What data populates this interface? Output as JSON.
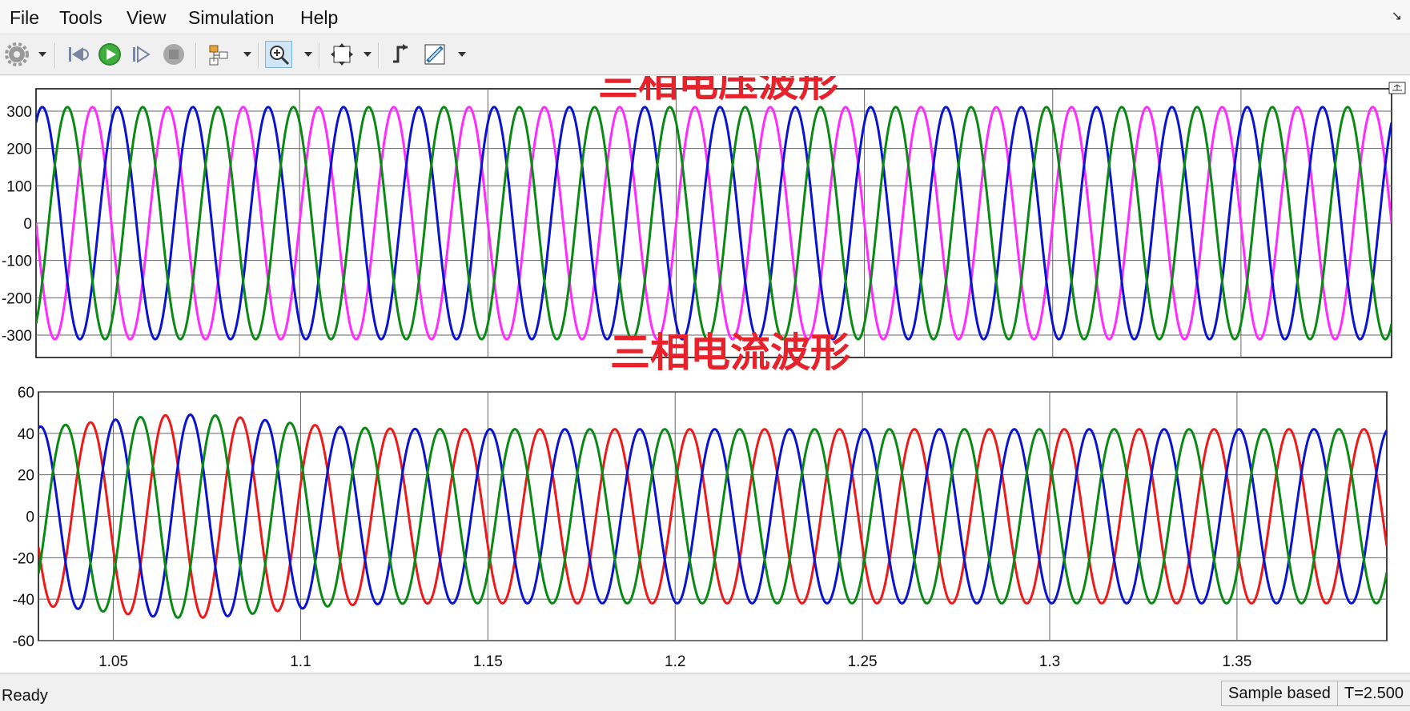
{
  "menu": [
    "File",
    "Tools",
    "View",
    "Simulation",
    "Help"
  ],
  "toolbar": {
    "icons": [
      "gear-icon",
      "step-back-icon",
      "run-icon",
      "step-forward-icon",
      "stop-icon",
      "signal-selector-icon",
      "zoom-in-icon",
      "fit-to-view-icon",
      "triggers-icon",
      "cursor-measurements-icon"
    ]
  },
  "status": {
    "text": "Ready",
    "sample_mode": "Sample based",
    "time": "T=2.500"
  },
  "colors": {
    "magenta": "#ff2bff",
    "blue": "#0a14d0",
    "green": "#0a8a14",
    "red": "#ee1a1a",
    "annotation": "#e8222a"
  },
  "chart_data": [
    {
      "type": "line",
      "title": "三相电压波形",
      "xlim": [
        1.03,
        1.39
      ],
      "ylim": [
        -360,
        360
      ],
      "yticks": [
        300,
        200,
        100,
        0,
        -100,
        -200,
        -300
      ],
      "ytick_labels": [
        "300",
        "200",
        "100",
        "0",
        "-100",
        "-200",
        "-300"
      ],
      "xticks": [
        1.05,
        1.1,
        1.15,
        1.2,
        1.25,
        1.3,
        1.35
      ],
      "grid": true,
      "frequency_hz": 50,
      "series": [
        {
          "color": "#ff2bff",
          "amplitude": 311,
          "phase_deg": 0
        },
        {
          "color": "#0a14d0",
          "amplitude": 311,
          "phase_deg": -120
        },
        {
          "color": "#0a8a14",
          "amplitude": 311,
          "phase_deg": 120
        }
      ]
    },
    {
      "type": "line",
      "title": "三相电流波形",
      "xlim": [
        1.03,
        1.39
      ],
      "ylim": [
        -60,
        60
      ],
      "yticks": [
        60,
        40,
        20,
        0,
        -20,
        -40,
        -60
      ],
      "ytick_labels": [
        "60",
        "40",
        "20",
        "0",
        "-20",
        "-40",
        "-60"
      ],
      "xticks": [
        1.05,
        1.1,
        1.15,
        1.2,
        1.25,
        1.3,
        1.35
      ],
      "xtick_labels": [
        "1.05",
        "1.1",
        "1.15",
        "1.2",
        "1.25",
        "1.3",
        "1.35"
      ],
      "grid": true,
      "frequency_hz": 50,
      "series": [
        {
          "color": "#ee1a1a",
          "amplitude": 42,
          "phase_deg": 20
        },
        {
          "color": "#0a14d0",
          "amplitude": 42,
          "phase_deg": -100
        },
        {
          "color": "#0a8a14",
          "amplitude": 42,
          "phase_deg": 140
        }
      ],
      "amplitude_peak": {
        "value": 49,
        "at_x": 1.07
      }
    }
  ]
}
